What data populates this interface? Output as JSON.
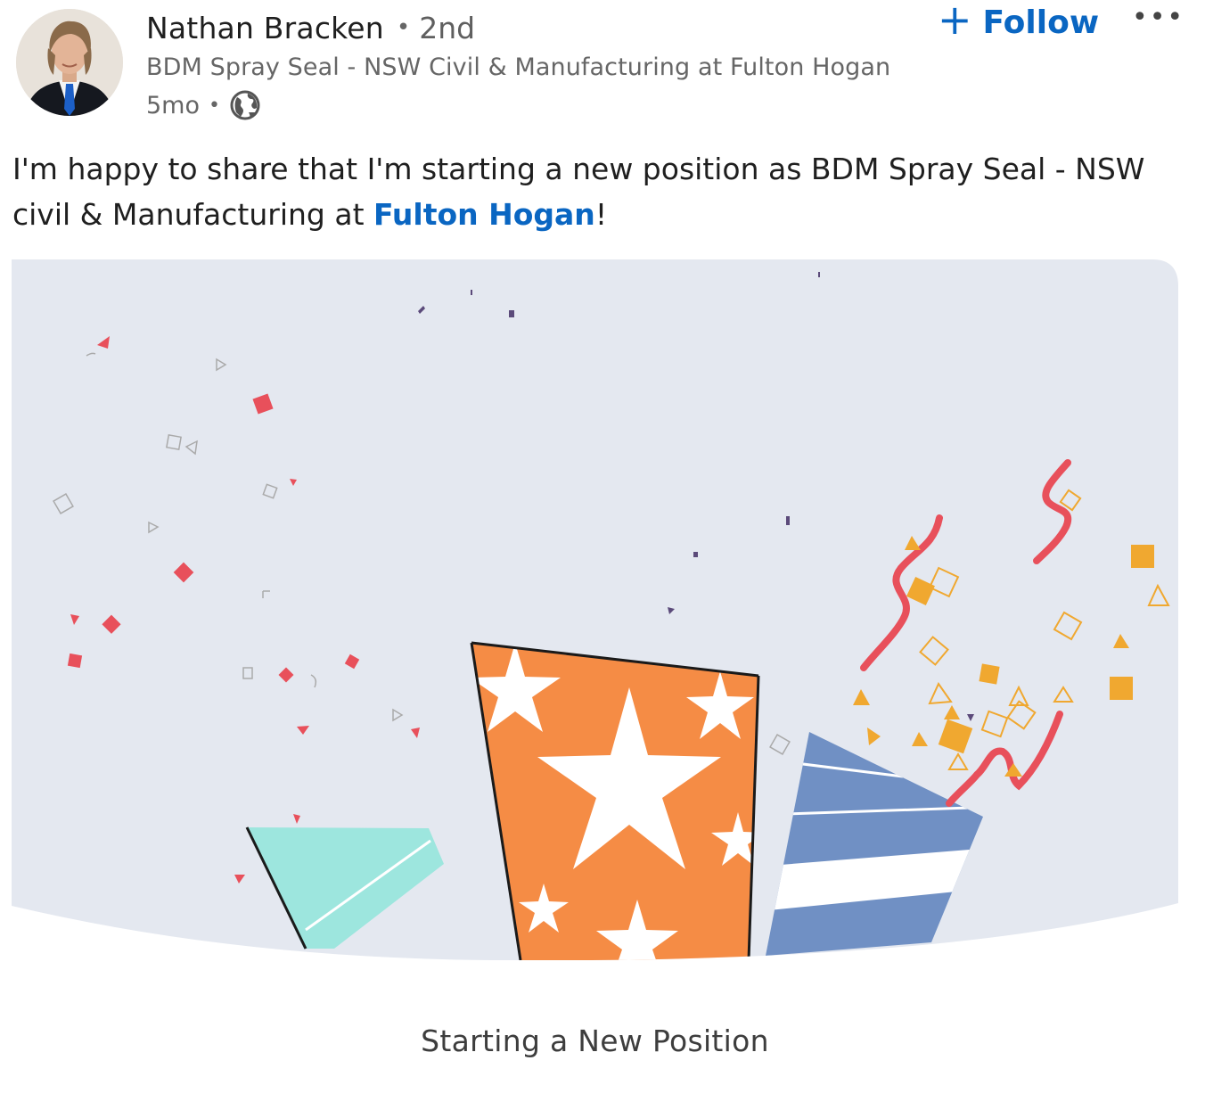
{
  "author": {
    "name": "Nathan Bracken",
    "degree": "2nd",
    "headline": "BDM Spray Seal - NSW Civil & Manufacturing at Fulton Hogan",
    "time": "5mo",
    "separator": "•"
  },
  "actions": {
    "follow_label": "Follow",
    "follow_icon": "+",
    "more_label": "•••"
  },
  "post": {
    "text_before": "I'm happy to share that I'm starting a new position as BDM Spray Seal - NSW civil & Manufacturing at ",
    "company": "Fulton Hogan",
    "text_after": "!"
  },
  "card": {
    "caption": "Starting a New Position"
  },
  "colors": {
    "link": "#0a66c2",
    "card_bg": "#e4e8f0",
    "orange": "#f58c45",
    "blue": "#7090c4",
    "teal": "#9de6de",
    "confetti_red": "#e8505b",
    "confetti_gold": "#f0a830"
  }
}
